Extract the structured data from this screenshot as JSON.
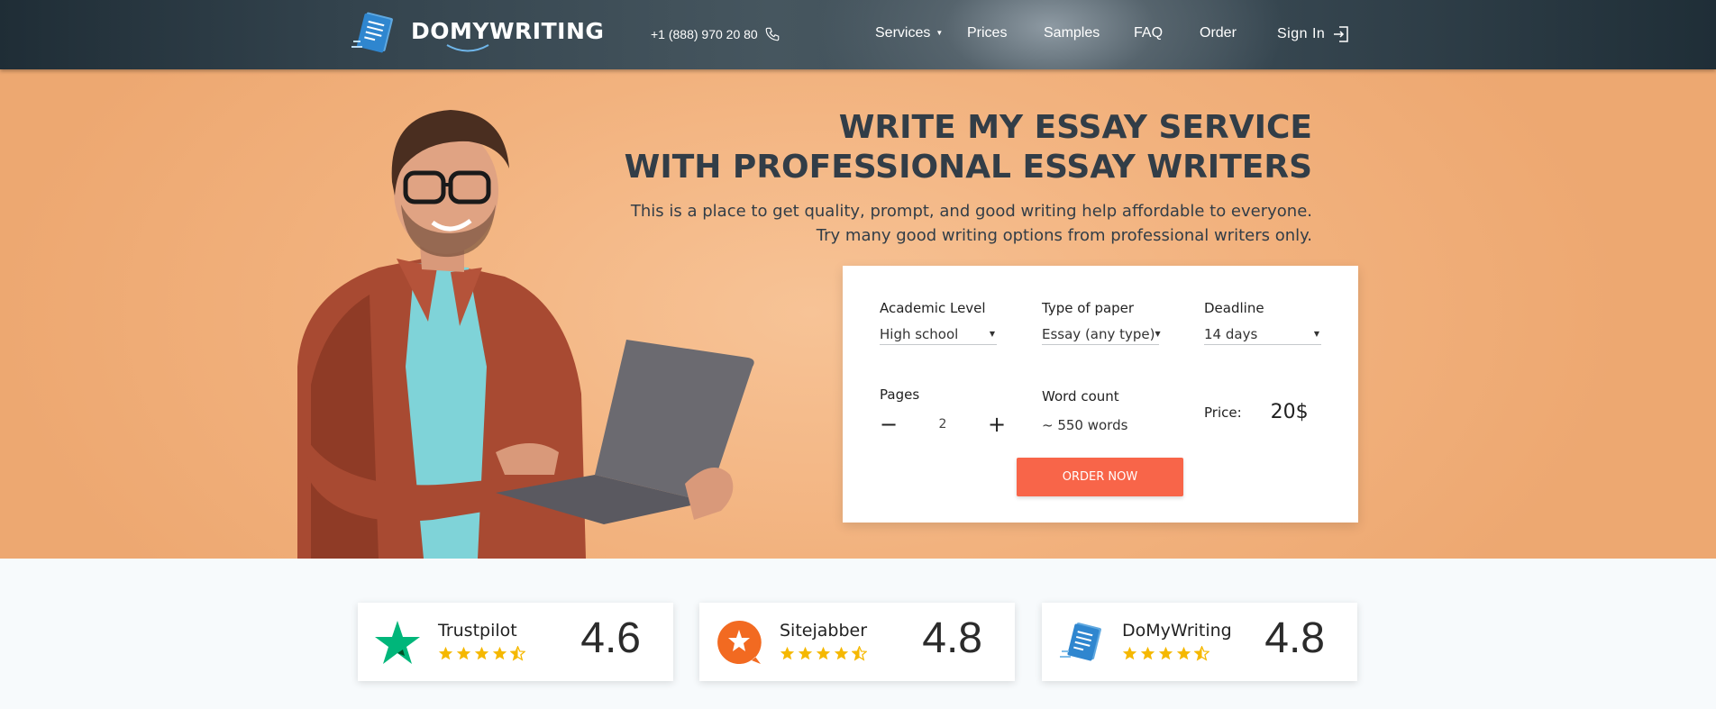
{
  "header": {
    "logo_text": "DOMYWRITING",
    "phone": "+1 (888) 970 20 80",
    "nav": {
      "services": "Services",
      "prices": "Prices",
      "samples": "Samples",
      "faq": "FAQ",
      "order": "Order",
      "sign_in": "Sign In"
    }
  },
  "hero": {
    "title_line1": "WRITE MY ESSAY SERVICE",
    "title_line2": "WITH PROFESSIONAL ESSAY WRITERS",
    "subtitle_line1": "This is a place to get quality, prompt, and good writing help affordable to everyone.",
    "subtitle_line2": "Try many good writing options from professional writers only."
  },
  "order_form": {
    "academic_level": {
      "label": "Academic Level",
      "value": "High school"
    },
    "type_of_paper": {
      "label": "Type of paper",
      "value": "Essay (any type)"
    },
    "deadline": {
      "label": "Deadline",
      "value": "14 days"
    },
    "pages": {
      "label": "Pages",
      "value": "2",
      "minus": "−",
      "plus": "+"
    },
    "word_count": {
      "label": "Word count",
      "value": "~ 550 words"
    },
    "price": {
      "label": "Price:",
      "value": "20$"
    },
    "order_button": "ORDER NOW"
  },
  "ratings": [
    {
      "name": "Trustpilot",
      "score": "4.6",
      "stars": 4.5,
      "icon": "trustpilot-star-icon"
    },
    {
      "name": "Sitejabber",
      "score": "4.8",
      "stars": 4.5,
      "icon": "sitejabber-icon"
    },
    {
      "name": "DoMyWriting",
      "score": "4.8",
      "stars": 4.5,
      "icon": "domywriting-logo-icon"
    }
  ],
  "colors": {
    "header_dark": "#2a3a44",
    "hero_bg": "#f2b27e",
    "accent": "#f86549",
    "star": "#f5b800",
    "trustpilot": "#00b67a",
    "sitejabber": "#f26a21"
  }
}
